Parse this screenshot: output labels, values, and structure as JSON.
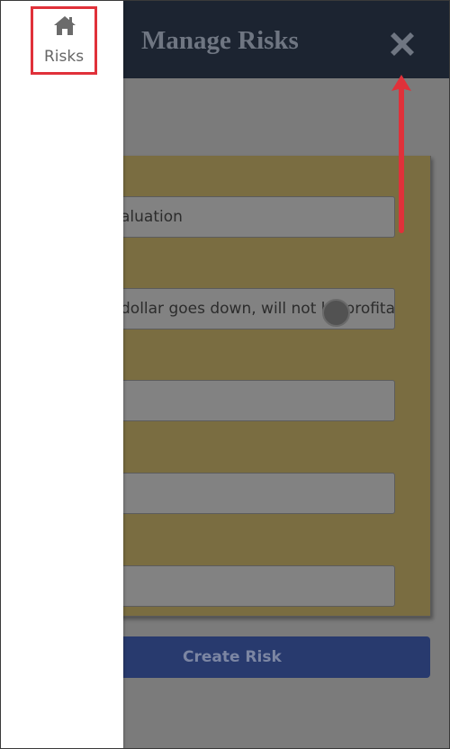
{
  "header": {
    "title": "Manage Risks",
    "close_icon": "close-icon"
  },
  "sidebar": {
    "items": [
      {
        "label": "Risks",
        "icon": "home-icon",
        "active": true
      }
    ],
    "highlight_color": "#e0313a"
  },
  "form": {
    "fields": [
      {
        "value": "aluation"
      },
      {
        "value": "dollar goes down, will not be profitable"
      },
      {
        "value": ""
      },
      {
        "value": ""
      },
      {
        "value": ""
      }
    ],
    "submit_label": "Create Risk"
  },
  "colors": {
    "header_bg": "#1c2431",
    "overlay_bg": "#7b7b7b",
    "card_bg": "#7a6d41",
    "button_bg": "#283a6e",
    "annotation": "#e0313a"
  }
}
